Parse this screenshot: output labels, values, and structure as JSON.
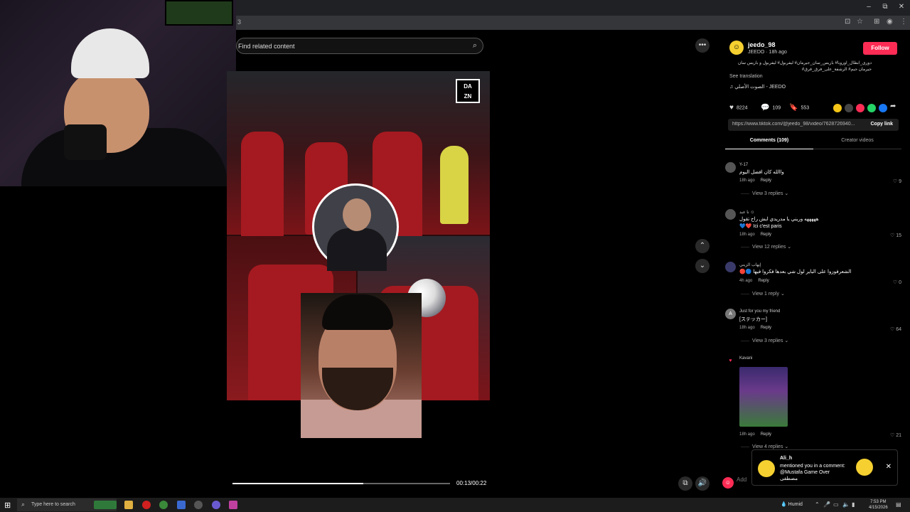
{
  "browser": {
    "url_fragment": "3",
    "window_buttons": [
      "–",
      "⧉",
      "✕"
    ]
  },
  "search": {
    "placeholder": "Find related content"
  },
  "video": {
    "watermark": "DA\nZN",
    "time": "00:13/00:22",
    "progress": 0.6
  },
  "author": {
    "username": "jeedo_98",
    "subline": "JEEDO · 18h ago",
    "follow_label": "Follow",
    "description": "دوري_ابطال_اوروبا# باريس_سان_جيرمان# ليفربول# ليفربول و باريس سان جيرمان جيم# الرشفة_على_فرق_فرق#",
    "see_translation": "See translation",
    "music": "♫  الصوت الأصلي - JEEDO"
  },
  "stats": {
    "likes": "8224",
    "comments": "109",
    "saves": "553"
  },
  "share_colors": [
    "#f5c518",
    "#444444",
    "#fe2c55",
    "#25d366",
    "#1877f2"
  ],
  "link": {
    "url": "https://www.tiktok.com/@jeedo_98/video/7628726940...",
    "copy_label": "Copy link"
  },
  "tabs": {
    "comments": "Comments (109)",
    "creator": "Creator videos"
  },
  "comments": [
    {
      "avatar": "",
      "name": "Y-17",
      "text": "واالله كان افضل اليوم",
      "time": "18h ago",
      "reply": "Reply",
      "likes": "9",
      "replies": "View 3 replies ⌄"
    },
    {
      "avatar": "",
      "name": "نا عبد ☺",
      "text": "هههههه وريني يا مدريدي ايش راح تقول",
      "text2": "💙❤️ Ici c'est paris",
      "time": "18h ago",
      "reply": "Reply",
      "likes": "15",
      "replies": "View 12 replies ⌄"
    },
    {
      "avatar": "",
      "name": "إيهاب الزيني",
      "text": "🔴🔵 الشعرفوزوا على الباير لول شي بعدها فكروا فيها",
      "time": "4h ago",
      "reply": "Reply",
      "likes": "0",
      "replies": "View 1 reply ⌄"
    },
    {
      "avatar": "A",
      "name": "Just for you my friend",
      "text": "[ステッカー]",
      "time": "18h ago",
      "reply": "Reply",
      "likes": "64",
      "replies": "View 3 replies ⌄"
    },
    {
      "avatar": "♥",
      "name": "Kavani",
      "text": "",
      "time": "18h ago",
      "reply": "Reply",
      "likes": "21",
      "replies": "View 4 replies ⌄"
    }
  ],
  "notification": {
    "name": "Ali_h",
    "text": "mentioned you in a comment: @Mustafa Game Over مصطفى",
    "close": "✕"
  },
  "add_comment_placeholder": "Add",
  "taskbar": {
    "search_placeholder": "Type here to search",
    "weather": "Humid",
    "time": "7:53 PM",
    "date": "4/15/2026"
  },
  "colors": {
    "accent": "#fe2c55",
    "panel_bg": "#000000"
  }
}
